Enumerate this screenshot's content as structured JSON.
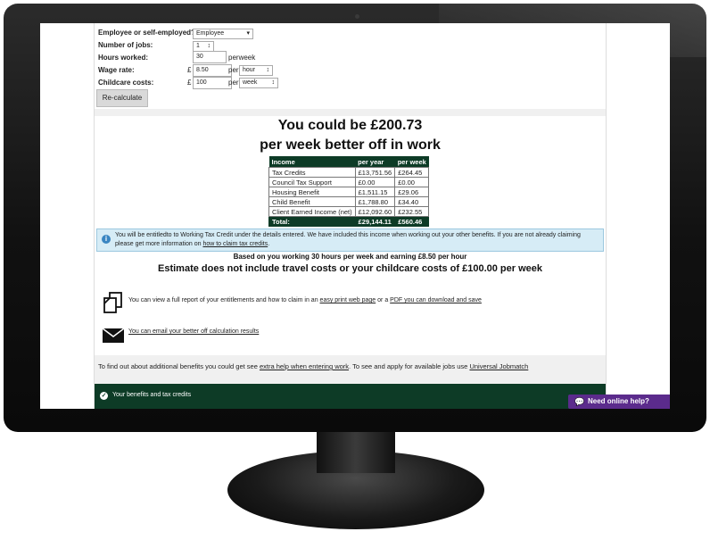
{
  "form": {
    "employment_label": "Employee or self-employed?",
    "employment_value": "Employee",
    "jobs_label": "Number of jobs:",
    "jobs_value": "1",
    "hours_label": "Hours worked:",
    "hours_value": "30",
    "hours_unit": "perweek",
    "wage_label": "Wage rate:",
    "wage_currency": "£",
    "wage_value": "8.50",
    "wage_per": "per",
    "wage_period": "hour",
    "childcare_label": "Childcare costs:",
    "childcare_currency": "£",
    "childcare_value": "100",
    "childcare_per": "per",
    "childcare_period": "week",
    "recalc_label": "Re-calculate"
  },
  "result": {
    "headline_1": "You could be £200.73",
    "headline_2": "per week better off in work"
  },
  "table": {
    "headers": [
      "Income",
      "per year",
      "per week"
    ],
    "rows": [
      [
        "Tax Credits",
        "£13,751.56",
        "£264.45"
      ],
      [
        "Council Tax Support",
        "£0.00",
        "£0.00"
      ],
      [
        "Housing Benefit",
        "£1,511.15",
        "£29.06"
      ],
      [
        "Child Benefit",
        "£1,788.80",
        "£34.40"
      ],
      [
        "Client Earned Income (net)",
        "£12,092.60",
        "£232.55"
      ]
    ],
    "total": [
      "Total:",
      "£29,144.11",
      "£560.46"
    ]
  },
  "info": {
    "text": "You will be entitledto to Working Tax Credit under the details entered. We have included this income when working out your other benefits. If you are not already claiming please get more information on",
    "link": "how to claim tax credits",
    "end": "."
  },
  "basis": {
    "line_1": "Based on you working 30 hours per week and earning £8.50 per hour",
    "line_2": "Estimate does not include travel costs or your childcare costs of £100.00 per week"
  },
  "report": {
    "text_1": "You can view a full report of your entitlements and how to claim in an",
    "link_1": "easy print web page",
    "text_2": "or a",
    "link_2": "PDF you can download and save"
  },
  "email": {
    "link": "You can email your better off calculation results"
  },
  "footer": {
    "text_1": "To find out about additional benefits you could get see",
    "link_1": "extra help when entering work",
    "text_2": ". To see and apply for available jobs use",
    "link_2": "Universal Jobmatch"
  },
  "greenbar": {
    "label": "Your benefits and tax credits"
  },
  "help": {
    "label": "Need online help?"
  },
  "icons": {
    "doc": "documents-icon",
    "mail": "envelope-icon",
    "info": "info-icon",
    "check": "check-circle-icon",
    "chat": "chat-icon"
  },
  "colors": {
    "brand_green": "#0d3b26",
    "help_purple": "#5b2b8c",
    "info_bg": "#d6ecf6"
  }
}
